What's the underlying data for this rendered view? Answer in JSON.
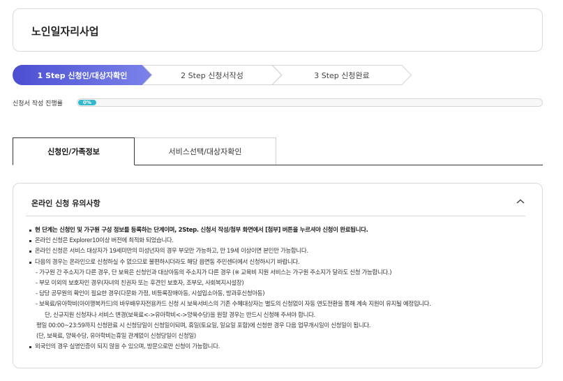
{
  "page": {
    "title": "노인일자리사업"
  },
  "steps": [
    {
      "label": "1 Step 신청인/대상자확인",
      "active": true
    },
    {
      "label": "2 Step 신청서작성",
      "active": false
    },
    {
      "label": "3 Step 신청완료",
      "active": false
    }
  ],
  "progress": {
    "label": "신청서 작성 진행률",
    "value_text": "0%",
    "value": 0
  },
  "tabs": [
    {
      "label": "신청인/가족정보",
      "active": true
    },
    {
      "label": "서비스선택/대상자확인",
      "active": false
    }
  ],
  "notice": {
    "title": "온라인 신청 유의사항",
    "lines": [
      "현 단계는 신청인 및 가구원 구성 정보를 등록하는 단계이며, 2Step. 신청서 작성/첨부 화면에서 [첨부] 버튼을 누르셔야 신청이 완료됩니다.",
      "온라인 신청은 Explorer10이상 버전에 최적화 되었습니다.",
      "온라인 신청은 서비스 대상자가 19세미만의 미성년자의 경우 부모만 가능하고, 만 19세 이상이면 본인만 가능합니다.",
      "다음의 경우는 온라인으로 신청하실 수 없으므로 불편하시더라도 해당 읍면동 주민센터에서 신청하시기 바랍니다.",
      "- 가구원 간 주소지가 다른 경우, 단 보육은 신청인과 대상아동의 주소지가 다른 경우 (※ 교육비 지원 서비스는 가구원 주소지가 달라도 신청 가능합니다.)",
      "- 부모 이외의 보호자인 경우(자녀의 친권자 또는 후견인 보호자, 조부모, 사회복지시설장)",
      "- 담당 공무원의 확인이 필요한 경우(다문화 가정, 비등록장애아동, 시설입소아동, 방과후신청아동)",
      "- 보육료/유아학비(아이행복카드)의 바우배우자전용카드 신청 시 보육서비스의 기존 수혜대상자는 별도의 신청없이 자동 연도전환을 통해 계속 지원이 유지될 예정입니다.",
      "단, 신규지원 신청자나 서비스 변경(보육료<->유아학비<->양육수당)을 원할 경우는 반드시 신청해 주셔야 합니다.",
      "평일 00:00~23:59까지 신청완료 시 신청당일이 신청일이되며, 휴일(토요일, 일요일 포함)에 신청한 경우 다음 업무개시일이 신청일이 됩니다.",
      "(단, 보육료, 양육수당, 유아학비는휴일 관계없이 신청당일이 신청일)",
      "외국인의 경우 실명인증이 되지 않을 수 있으며, 방문으로만 신청이 가능합니다."
    ]
  },
  "colors": {
    "step_active_start": "#4b4fd1",
    "step_active_end": "#7b83ea",
    "progress_fill": "#35b8cf"
  },
  "icons": {
    "collapse": "chevron-up-icon"
  }
}
